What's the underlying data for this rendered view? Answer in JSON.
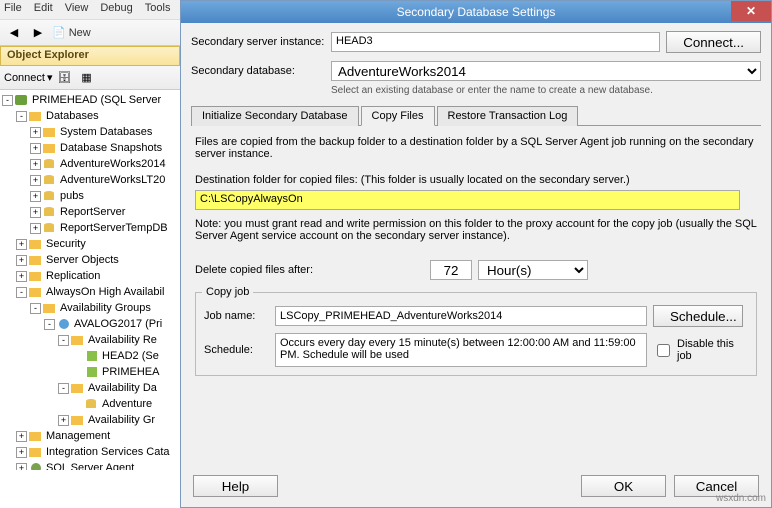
{
  "menu": [
    "File",
    "Edit",
    "View",
    "Debug",
    "Tools"
  ],
  "toolbar": {
    "new": "New"
  },
  "explorer": {
    "title": "Object Explorer",
    "connect": "Connect",
    "root": "PRIMEHEAD (SQL Server",
    "nodes": {
      "databases": "Databases",
      "sysdb": "System Databases",
      "snapshots": "Database Snapshots",
      "aw2014": "AdventureWorks2014",
      "awlt20": "AdventureWorksLT20",
      "pubs": "pubs",
      "reportserver": "ReportServer",
      "reportservertemp": "ReportServerTempDB",
      "security": "Security",
      "serverobjects": "Server Objects",
      "replication": "Replication",
      "alwayson": "AlwaysOn High Availabil",
      "availgroups": "Availability Groups",
      "avalog": "AVALOG2017 (Pri",
      "availreplicas": "Availability Re",
      "head2": "HEAD2 (Se",
      "primehead": "PRIMEHEA",
      "availdb": "Availability Da",
      "adventure": "Adventure",
      "availgl": "Availability Gr",
      "management": "Management",
      "integration": "Integration Services Cata",
      "sqlagent": "SQL Server Agent"
    }
  },
  "dialog": {
    "title": "Secondary Database Settings",
    "labels": {
      "serverinstance": "Secondary server instance:",
      "database": "Secondary database:",
      "note": "Select an existing database or enter the name to create a new database.",
      "connect": "Connect...",
      "destnote": "Files are copied from the backup folder to a destination folder by a SQL Server Agent job running on the secondary server instance.",
      "destfolder": "Destination folder for copied files: (This folder is usually located on the secondary server.)",
      "grantnote": "Note: you must grant read and write permission on this folder to the proxy account for the copy job (usually the SQL Server Agent service account on the secondary server instance).",
      "deleteafter": "Delete copied files after:",
      "copyjob": "Copy job",
      "jobname": "Job name:",
      "schedule": "Schedule:",
      "schedbtn": "Schedule...",
      "disable": "Disable this job",
      "help": "Help",
      "ok": "OK",
      "cancel": "Cancel"
    },
    "values": {
      "serverinstance": "HEAD3",
      "database": "AdventureWorks2014",
      "destfolder": "C:\\LSCopyAlwaysOn",
      "deletevalue": "72",
      "deleteunit": "Hour(s)",
      "jobname": "LSCopy_PRIMEHEAD_AdventureWorks2014",
      "scheduletext": "Occurs every day every 15 minute(s) between 12:00:00 AM and 11:59:00 PM. Schedule will be used"
    },
    "tabs": {
      "init": "Initialize Secondary Database",
      "copy": "Copy Files",
      "restore": "Restore Transaction Log"
    }
  },
  "watermark": "wsxdn.com"
}
